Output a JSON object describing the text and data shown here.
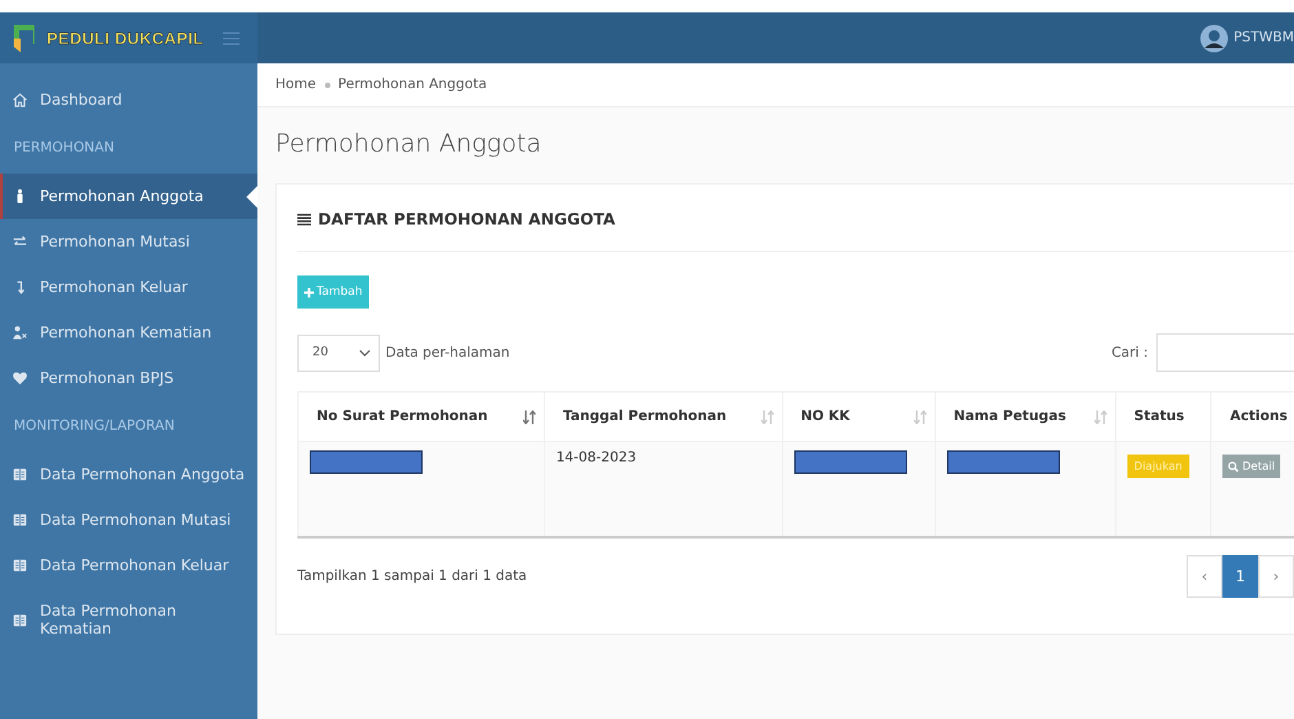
{
  "app": {
    "title": "PEDULI DUKCAPIL",
    "user": "PSTWBM"
  },
  "sidebar": {
    "items": [
      {
        "kind": "link",
        "label": "Dashboard",
        "selected": false
      },
      {
        "kind": "section",
        "label": "PERMOHONAN"
      },
      {
        "kind": "link",
        "label": "Permohonan Anggota",
        "selected": true
      },
      {
        "kind": "link",
        "label": "Permohonan Mutasi",
        "selected": false
      },
      {
        "kind": "link",
        "label": "Permohonan Keluar",
        "selected": false
      },
      {
        "kind": "link",
        "label": "Permohonan Kematian",
        "selected": false
      },
      {
        "kind": "link",
        "label": "Permohonan BPJS",
        "selected": false
      },
      {
        "kind": "section",
        "label": "MONITORING/LAPORAN"
      },
      {
        "kind": "link",
        "label": "Data Permohonan Anggota",
        "selected": false
      },
      {
        "kind": "link",
        "label": "Data Permohonan Mutasi",
        "selected": false
      },
      {
        "kind": "link",
        "label": "Data Permohonan Keluar",
        "selected": false
      },
      {
        "kind": "link",
        "label": "Data Permohonan Kematian",
        "selected": false
      }
    ]
  },
  "breadcrumb": [
    "Home",
    "Permohonan Anggota"
  ],
  "page_title": "Permohonan Anggota",
  "panel": {
    "title": "DAFTAR PERMOHONAN ANGGOTA",
    "add_button": "Tambah",
    "page_size": "20",
    "page_size_label": "Data per-halaman",
    "search_label": "Cari :",
    "table": {
      "columns": [
        {
          "label": "No Surat Permohonan",
          "sorted": true
        },
        {
          "label": "Tanggal Permohonan",
          "sorted": false
        },
        {
          "label": "NO KK",
          "sorted": false
        },
        {
          "label": "Nama Petugas",
          "sorted": false
        },
        {
          "label": "Status"
        },
        {
          "label": "Actions"
        }
      ],
      "rows": [
        {
          "cells": [
            {
              "kind": "redacted"
            },
            {
              "kind": "text",
              "text": "14-08-2023"
            },
            {
              "kind": "redacted"
            },
            {
              "kind": "redacted"
            },
            {
              "kind": "status",
              "text": "Diajukan"
            },
            {
              "kind": "action",
              "text": "Detail"
            }
          ]
        }
      ]
    },
    "info": "Tampilkan 1 sampai 1 dari 1 data",
    "pagination": [
      {
        "kind": "prev",
        "label": "‹"
      },
      {
        "kind": "page",
        "label": "1",
        "selected": true
      },
      {
        "kind": "next",
        "label": "›"
      }
    ]
  }
}
